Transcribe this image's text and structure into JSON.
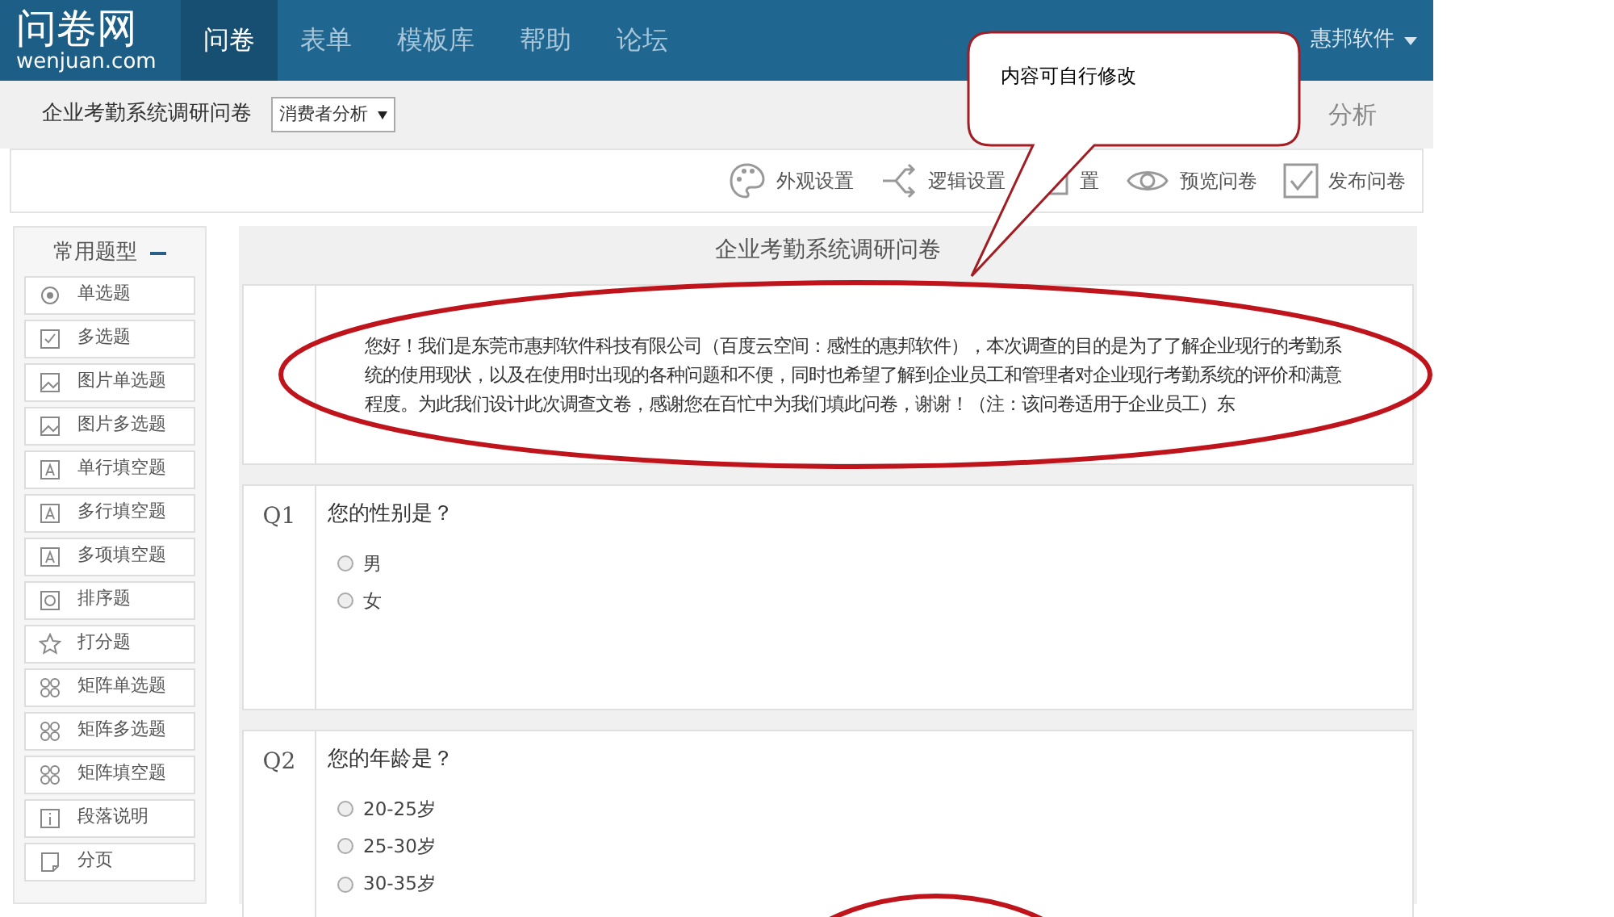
{
  "header": {
    "logo_title": "问卷网",
    "logo_domain": "wenjuan.com",
    "nav": [
      {
        "label": "问卷",
        "selected": true
      },
      {
        "label": "表单",
        "selected": false
      },
      {
        "label": "模板库",
        "selected": false
      },
      {
        "label": "帮助",
        "selected": false
      },
      {
        "label": "论坛",
        "selected": false
      }
    ],
    "user": "惠邦软件"
  },
  "subbar": {
    "survey_name": "企业考勤系统调研问卷",
    "dropdown": "消费者分析",
    "right_text": "分析"
  },
  "toolbar": [
    {
      "label": "外观设置",
      "kind": "palette"
    },
    {
      "label": "逻辑设置",
      "kind": "logic"
    },
    {
      "label": "置",
      "kind": "folder"
    },
    {
      "label": "预览问卷",
      "kind": "eye"
    },
    {
      "label": "发布问卷",
      "kind": "check"
    }
  ],
  "sidebar": {
    "title": "常用题型",
    "items": [
      {
        "label": "单选题",
        "kind": "radio"
      },
      {
        "label": "多选题",
        "kind": "checkbox"
      },
      {
        "label": "图片单选题",
        "kind": "image"
      },
      {
        "label": "图片多选题",
        "kind": "image"
      },
      {
        "label": "单行填空题",
        "kind": "text"
      },
      {
        "label": "多行填空题",
        "kind": "text"
      },
      {
        "label": "多项填空题",
        "kind": "text"
      },
      {
        "label": "排序题",
        "kind": "sort"
      },
      {
        "label": "打分题",
        "kind": "star"
      },
      {
        "label": "矩阵单选题",
        "kind": "matrix"
      },
      {
        "label": "矩阵多选题",
        "kind": "matrix"
      },
      {
        "label": "矩阵填空题",
        "kind": "matrix"
      },
      {
        "label": "段落说明",
        "kind": "info"
      },
      {
        "label": "分页",
        "kind": "page"
      }
    ]
  },
  "survey": {
    "title": "企业考勤系统调研问卷",
    "intro": "您好！我们是东莞市惠邦软件科技有限公司（百度云空间：感性的惠邦软件），本次调查的目的是为了了解企业现行的考勤系统的使用现状，以及在使用时出现的各种问题和不便，同时也希望了解到企业员工和管理者对企业现行考勤系统的评价和满意程度。为此我们设计此次调查文卷，感谢您在百忙中为我们填此问卷，谢谢！（注：该问卷适用于企业员工）东",
    "questions": [
      {
        "number": "Q1",
        "text": "您的性别是？",
        "options": [
          {
            "label": "男",
            "selected": false
          },
          {
            "label": "女",
            "selected": false
          }
        ]
      },
      {
        "number": "Q2",
        "text": "您的年龄是？",
        "options": [
          {
            "label": "20-25岁",
            "selected": false
          },
          {
            "label": "25-30岁",
            "selected": false
          },
          {
            "label": "30-35岁",
            "selected": false
          }
        ]
      }
    ]
  },
  "callout": {
    "text": "内容可自行修改"
  }
}
